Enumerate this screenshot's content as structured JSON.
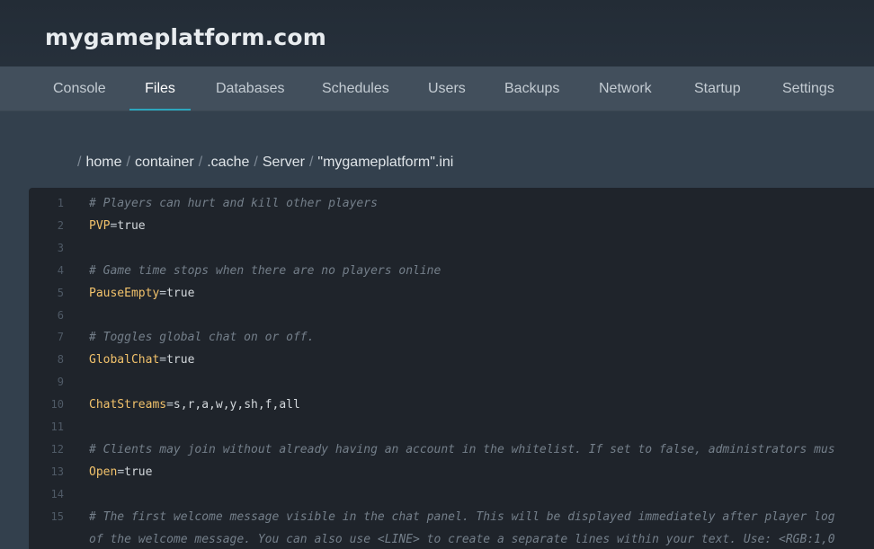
{
  "site": {
    "title": "mygameplatform.com"
  },
  "nav": {
    "tabs": [
      {
        "label": "Console"
      },
      {
        "label": "Files"
      },
      {
        "label": "Databases"
      },
      {
        "label": "Schedules"
      },
      {
        "label": "Users"
      },
      {
        "label": "Backups"
      },
      {
        "label": "Network"
      },
      {
        "label": "Startup"
      },
      {
        "label": "Settings"
      }
    ],
    "active": "Files"
  },
  "breadcrumb": {
    "separator": "/",
    "segments": [
      "home",
      "container",
      ".cache",
      "Server"
    ],
    "file": "\"mygameplatform\".ini"
  },
  "editor": {
    "lines": [
      {
        "n": "1",
        "comment": "# Players can hurt and kill other players"
      },
      {
        "n": "2",
        "key": "PVP",
        "value": "true"
      },
      {
        "n": "3"
      },
      {
        "n": "4",
        "comment": "# Game time stops when there are no players online"
      },
      {
        "n": "5",
        "key": "PauseEmpty",
        "value": "true"
      },
      {
        "n": "6"
      },
      {
        "n": "7",
        "comment": "# Toggles global chat on or off."
      },
      {
        "n": "8",
        "key": "GlobalChat",
        "value": "true"
      },
      {
        "n": "9"
      },
      {
        "n": "10",
        "key": "ChatStreams",
        "value": "s,r,a,w,y,sh,f,all"
      },
      {
        "n": "11"
      },
      {
        "n": "12",
        "comment": "# Clients may join without already having an account in the whitelist. If set to false, administrators mus"
      },
      {
        "n": "13",
        "key": "Open",
        "value": "true"
      },
      {
        "n": "14"
      },
      {
        "n": "15",
        "comment": "# The first welcome message visible in the chat panel. This will be displayed immediately after player log"
      },
      {
        "n": "",
        "comment": "of the welcome message. You can also use <LINE> to create a separate lines within your text. Use: <RGB:1,0"
      }
    ]
  }
}
